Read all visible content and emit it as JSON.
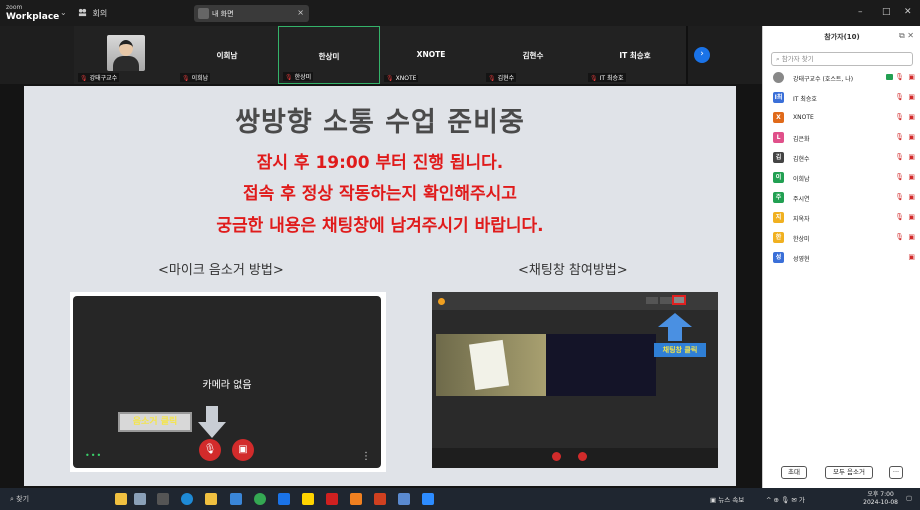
{
  "titlebar": {
    "logo_top": "zoom",
    "logo_bottom": "Workplace",
    "meeting_label": "회의",
    "tab_label": "내 화면",
    "tab_close": "×",
    "minimize": "–",
    "maximize": "□",
    "close": "✕"
  },
  "strip": {
    "tiles": [
      {
        "name": "",
        "caption": "강태구교수"
      },
      {
        "name": "이희남",
        "caption": "이희남"
      },
      {
        "name": "한상미",
        "caption": "한상미"
      },
      {
        "name": "XNOTE",
        "caption": "XNOTE"
      },
      {
        "name": "김현수",
        "caption": "김현수"
      },
      {
        "name": "IT 최승호",
        "caption": "IT 최승호"
      }
    ],
    "next": "›"
  },
  "slide": {
    "title": "쌍방향 소통 수업 준비중",
    "line1": "잠시 후 19:00 부터 진행 됩니다.",
    "line2": "접속 후 정상 작동하는지 확인해주시고",
    "line3": "궁금한 내용은 채팅창에 남겨주시기 바랍니다.",
    "sub_mic": "<마이크 음소거 방법>",
    "sub_chat": "<채팅창 참여방법>",
    "no_camera": "카메라 없음",
    "mute_click": "음소거 클릭",
    "chat_click": "채팅창 클릭"
  },
  "panel": {
    "title": "참가자(10)",
    "search_placeholder": "참가자 찾기",
    "participants": [
      {
        "initial": "",
        "name": "강태구교수 (호스트, 나)",
        "color": "#888888"
      },
      {
        "initial": "I최",
        "name": "IT 최승호",
        "color": "#3a6fd8"
      },
      {
        "initial": "X",
        "name": "XNOTE",
        "color": "#e06a1a"
      },
      {
        "initial": "L",
        "name": "김은화",
        "color": "#e0508a"
      },
      {
        "initial": "김",
        "name": "김현수",
        "color": "#444444"
      },
      {
        "initial": "이",
        "name": "이희남",
        "color": "#22a052"
      },
      {
        "initial": "주",
        "name": "주시연",
        "color": "#22a052"
      },
      {
        "initial": "지",
        "name": "지옥자",
        "color": "#f0b020"
      },
      {
        "initial": "한",
        "name": "한상미",
        "color": "#f0b020"
      },
      {
        "initial": "성",
        "name": "성영현",
        "color": "#3a6fd8"
      }
    ],
    "invite": "초대",
    "mute_all": "모두 음소거",
    "more": "···"
  },
  "taskbar": {
    "search": "찾기",
    "news": "뉴스 속보",
    "tray": "^ ⊕ 🎙 ✉ 가",
    "time": "오후 7:00",
    "date": "2024-10-08"
  }
}
